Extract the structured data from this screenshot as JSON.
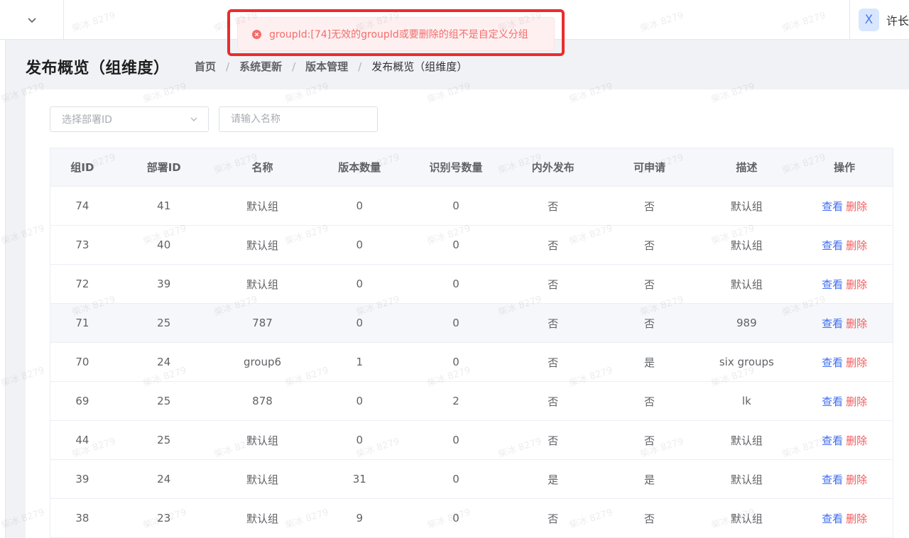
{
  "header": {
    "user_avatar_letter": "X",
    "user_name": "许长"
  },
  "toast": {
    "type": "error",
    "message": "groupId:[74]无效的groupId或要删除的组不是自定义分组"
  },
  "page": {
    "title": "发布概览（组维度）",
    "breadcrumb": [
      "首页",
      "系统更新",
      "版本管理",
      "发布概览（组维度）"
    ]
  },
  "filters": {
    "deploy_id_placeholder": "选择部署ID",
    "name_placeholder": "请输入名称"
  },
  "table": {
    "columns": [
      "组ID",
      "部署ID",
      "名称",
      "版本数量",
      "识别号数量",
      "内外发布",
      "可申请",
      "描述",
      "操作"
    ],
    "action_view": "查看",
    "action_delete": "删除",
    "rows": [
      [
        "74",
        "41",
        "默认组",
        "0",
        "0",
        "否",
        "否",
        "默认组"
      ],
      [
        "73",
        "40",
        "默认组",
        "0",
        "0",
        "否",
        "否",
        "默认组"
      ],
      [
        "72",
        "39",
        "默认组",
        "0",
        "0",
        "否",
        "否",
        "默认组"
      ],
      [
        "71",
        "25",
        "787",
        "0",
        "0",
        "否",
        "否",
        "989"
      ],
      [
        "70",
        "24",
        "group6",
        "1",
        "0",
        "否",
        "是",
        "six groups"
      ],
      [
        "69",
        "25",
        "878",
        "0",
        "2",
        "否",
        "否",
        "lk"
      ],
      [
        "44",
        "25",
        "默认组",
        "0",
        "0",
        "否",
        "否",
        "默认组"
      ],
      [
        "39",
        "24",
        "默认组",
        "31",
        "0",
        "是",
        "是",
        "默认组"
      ],
      [
        "38",
        "23",
        "默认组",
        "9",
        "0",
        "否",
        "否",
        "默认组"
      ]
    ]
  },
  "watermark": {
    "text": "柴冰 8279"
  },
  "colors": {
    "primary": "#3d6df2",
    "danger": "#f35a5a",
    "error_highlight": "#ea2c2c"
  }
}
